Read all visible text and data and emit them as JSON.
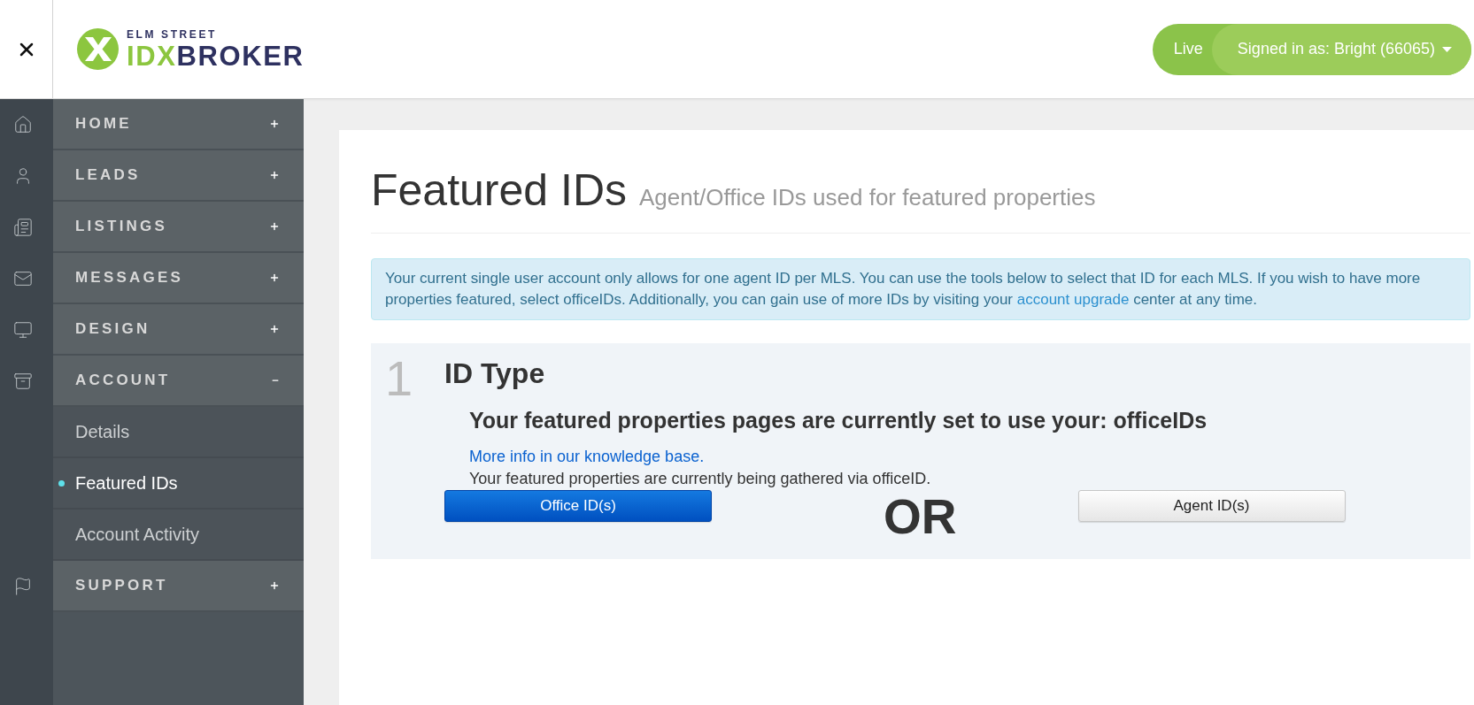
{
  "header": {
    "logo": {
      "tagline": "ELM STREET",
      "accent": "IDX",
      "name": "BROKER"
    },
    "account": {
      "status": "Live",
      "user": "Signed in as: Bright (66065)"
    }
  },
  "sidebar": {
    "items": [
      {
        "label": "HOME",
        "expanded": false
      },
      {
        "label": "LEADS",
        "expanded": false
      },
      {
        "label": "LISTINGS",
        "expanded": false
      },
      {
        "label": "MESSAGES",
        "expanded": false
      },
      {
        "label": "DESIGN",
        "expanded": false
      },
      {
        "label": "ACCOUNT",
        "expanded": true,
        "children": [
          {
            "label": "Details",
            "selected": false
          },
          {
            "label": "Featured IDs",
            "selected": true
          },
          {
            "label": "Account Activity",
            "selected": false
          }
        ]
      },
      {
        "label": "SUPPORT",
        "expanded": false
      }
    ]
  },
  "page": {
    "title": "Featured IDs",
    "subtitle": "Agent/Office IDs used for featured properties"
  },
  "notice": {
    "text_before": "Your current single user account only allows for one agent ID per MLS. You can use the tools below to select that ID for each MLS. If you wish to have more properties featured, select officeIDs. Additionally, you can gain use of more IDs by visiting your",
    "link": "account upgrade",
    "text_after": "center at any time."
  },
  "step": {
    "number": "1",
    "title": "ID Type",
    "status": "Your featured properties pages are currently set to use your: officeIDs",
    "help_link": "More info in our knowledge base.",
    "note": "Your featured properties are currently being gathered via officeID.",
    "options": [
      {
        "label": "Office ID(s)",
        "selected": true
      },
      {
        "label": "Agent ID(s)",
        "selected": false
      }
    ],
    "separator": "OR"
  }
}
